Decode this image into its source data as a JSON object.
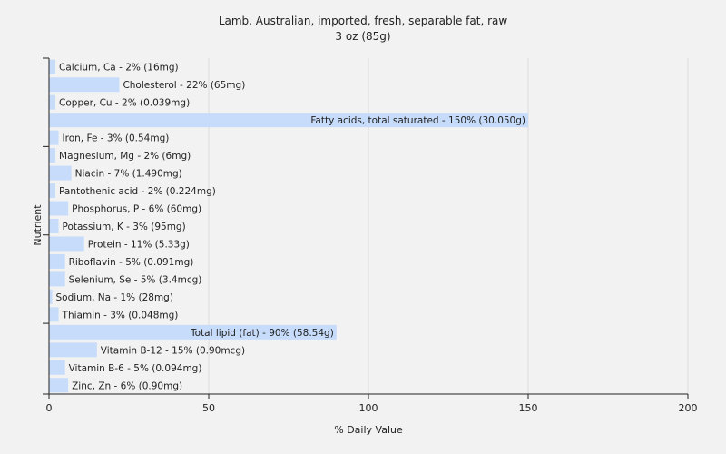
{
  "chart_data": {
    "type": "bar",
    "orientation": "horizontal",
    "title": "Lamb, Australian, imported, fresh, separable fat, raw",
    "subtitle": "3 oz (85g)",
    "xlabel": "% Daily Value",
    "ylabel": "Nutrient",
    "xlim": [
      0,
      200
    ],
    "xticks": [
      0,
      50,
      100,
      150,
      200
    ],
    "grid": true,
    "bar_color": "#c6dcfa",
    "categories": [
      "Calcium, Ca",
      "Cholesterol",
      "Copper, Cu",
      "Fatty acids, total saturated",
      "Iron, Fe",
      "Magnesium, Mg",
      "Niacin",
      "Pantothenic acid",
      "Phosphorus, P",
      "Potassium, K",
      "Protein",
      "Riboflavin",
      "Selenium, Se",
      "Sodium, Na",
      "Thiamin",
      "Total lipid (fat)",
      "Vitamin B-12",
      "Vitamin B-6",
      "Zinc, Zn"
    ],
    "values": [
      2,
      22,
      2,
      150,
      3,
      2,
      7,
      2,
      6,
      3,
      11,
      5,
      5,
      1,
      3,
      90,
      15,
      5,
      6
    ],
    "labels": [
      "Calcium, Ca - 2% (16mg)",
      "Cholesterol - 22% (65mg)",
      "Copper, Cu - 2% (0.039mg)",
      "Fatty acids, total saturated - 150% (30.050g)",
      "Iron, Fe - 3% (0.54mg)",
      "Magnesium, Mg - 2% (6mg)",
      "Niacin - 7% (1.490mg)",
      "Pantothenic acid - 2% (0.224mg)",
      "Phosphorus, P - 6% (60mg)",
      "Potassium, K - 3% (95mg)",
      "Protein - 11% (5.33g)",
      "Riboflavin - 5% (0.091mg)",
      "Selenium, Se - 5% (3.4mcg)",
      "Sodium, Na - 1% (28mg)",
      "Thiamin - 3% (0.048mg)",
      "Total lipid (fat) - 90% (58.54g)",
      "Vitamin B-12 - 15% (0.90mcg)",
      "Vitamin B-6 - 5% (0.094mg)",
      "Zinc, Zn - 6% (0.90mg)"
    ]
  }
}
